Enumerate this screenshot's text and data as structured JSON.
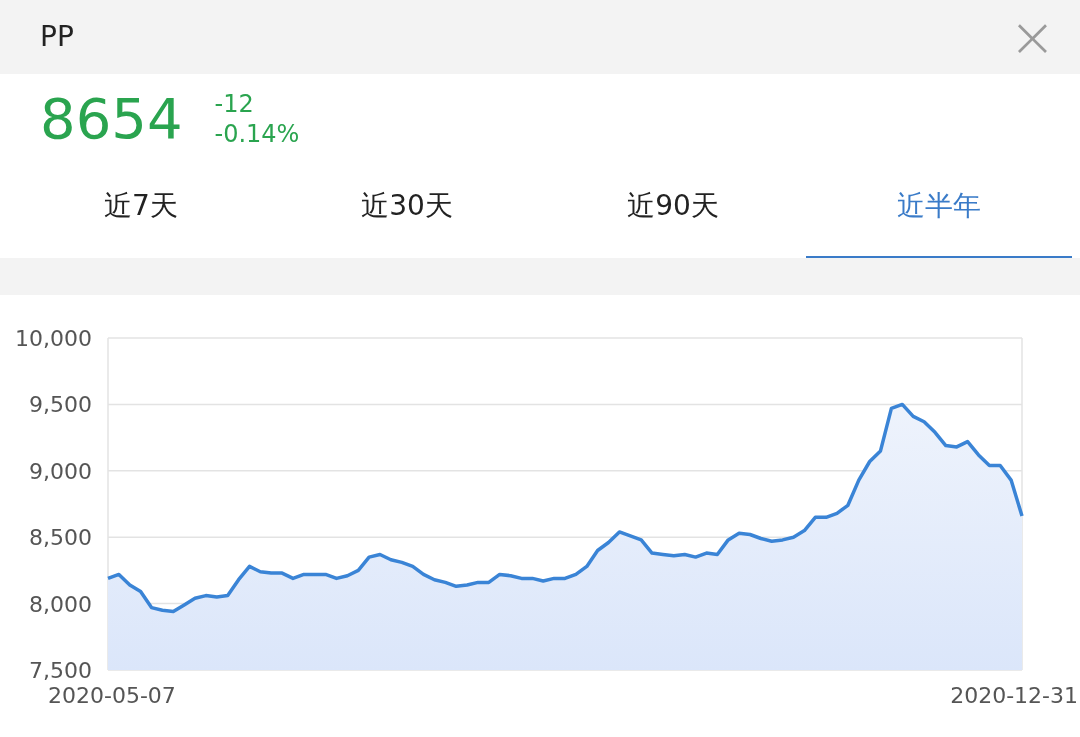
{
  "header": {
    "title": "PP",
    "close": "×"
  },
  "quote": {
    "price": "8654",
    "change": "-12",
    "change_percent": "-0.14%"
  },
  "tabs": [
    {
      "label": "近7天",
      "selected": false
    },
    {
      "label": "近30天",
      "selected": false
    },
    {
      "label": "近90天",
      "selected": false
    },
    {
      "label": "近半年",
      "selected": true
    }
  ],
  "chart": {
    "x_labels": [
      "2020-05-07",
      "2020-12-31"
    ],
    "chart_data": {
      "type": "area",
      "grid": true,
      "ylim": [
        7500,
        10000
      ],
      "yticks": [
        {
          "value": 10000,
          "label": "10,000"
        },
        {
          "value": 9500,
          "label": "9,500"
        },
        {
          "value": 9000,
          "label": "9,000"
        },
        {
          "value": 8500,
          "label": "8,500"
        },
        {
          "value": 8000,
          "label": "8,000"
        },
        {
          "value": 7500,
          "label": "7,500"
        }
      ],
      "values": [
        8190,
        8220,
        8140,
        8090,
        7970,
        7950,
        7940,
        7990,
        8040,
        8060,
        8050,
        8060,
        8180,
        8280,
        8240,
        8230,
        8230,
        8190,
        8220,
        8220,
        8220,
        8190,
        8210,
        8250,
        8350,
        8370,
        8330,
        8310,
        8280,
        8220,
        8180,
        8160,
        8130,
        8140,
        8160,
        8160,
        8220,
        8210,
        8190,
        8190,
        8170,
        8190,
        8190,
        8220,
        8280,
        8400,
        8460,
        8540,
        8510,
        8480,
        8380,
        8370,
        8360,
        8370,
        8350,
        8380,
        8370,
        8480,
        8530,
        8520,
        8490,
        8470,
        8480,
        8500,
        8550,
        8650,
        8650,
        8680,
        8740,
        8930,
        9070,
        9150,
        9470,
        9500,
        9410,
        9370,
        9290,
        9190,
        9180,
        9220,
        9120,
        9040,
        9040,
        8930,
        8660
      ]
    }
  }
}
